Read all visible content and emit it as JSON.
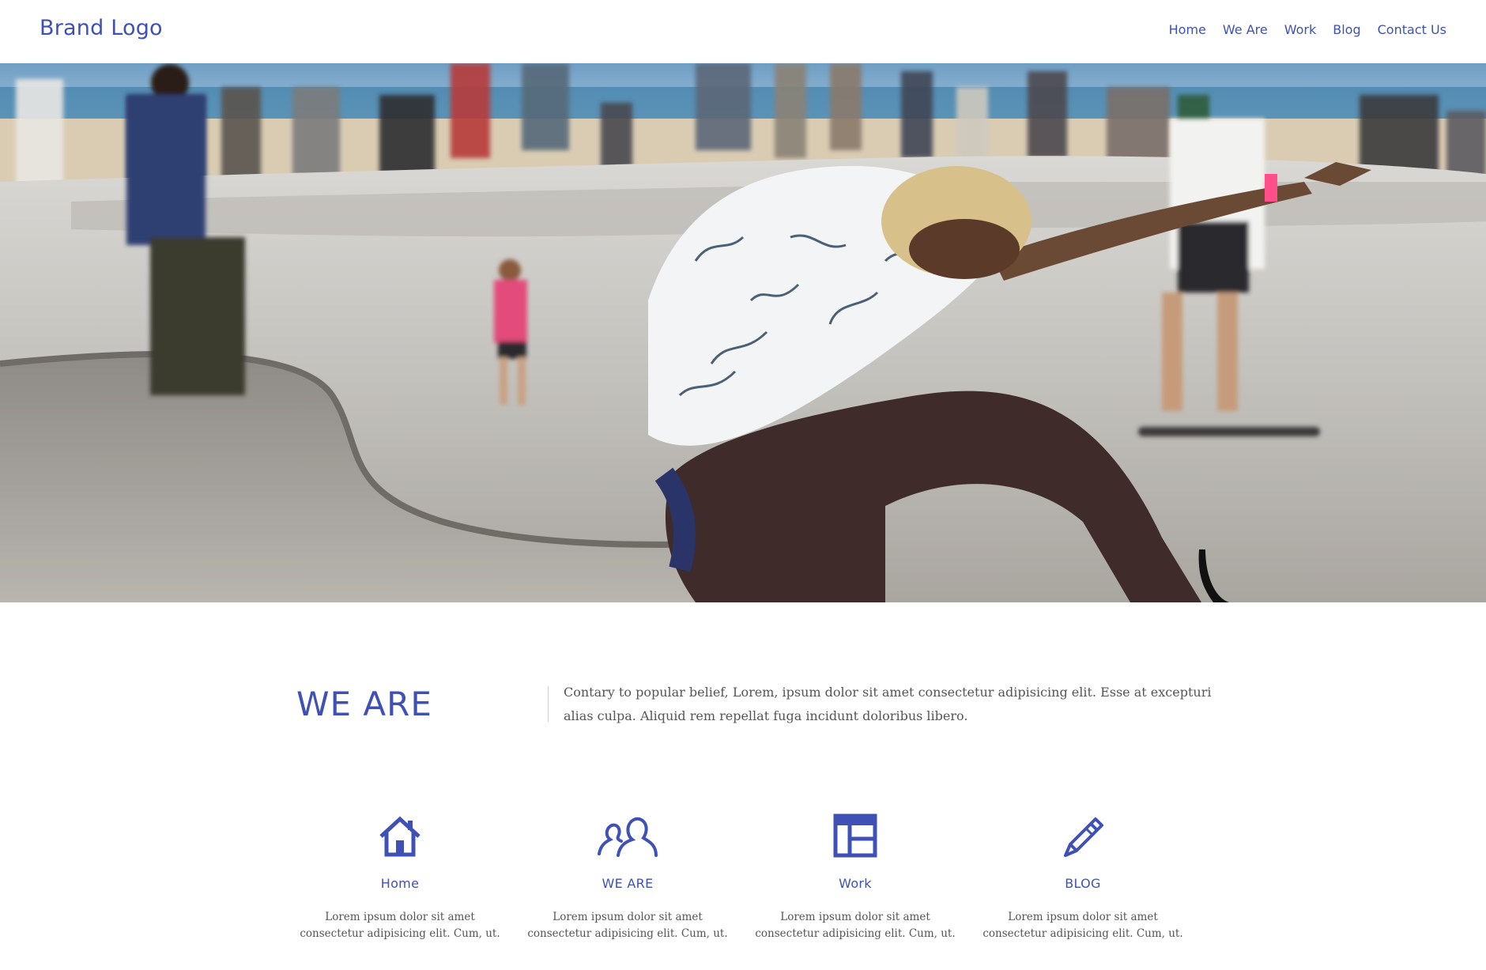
{
  "header": {
    "brand": "Brand Logo",
    "nav": [
      {
        "label": "Home"
      },
      {
        "label": "We Are"
      },
      {
        "label": "Work"
      },
      {
        "label": "Blog"
      },
      {
        "label": "Contact Us"
      }
    ]
  },
  "hero": {
    "image": "skatepark-photo"
  },
  "about": {
    "title": "WE ARE",
    "text": "Contary to popular belief, Lorem, ipsum dolor sit amet consectetur adipisicing elit. Esse at excepturi alias culpa. Aliquid rem repellat fuga incidunt doloribus libero."
  },
  "features": [
    {
      "icon": "home-icon",
      "title": "Home",
      "text": "Lorem ipsum dolor sit amet consectetur adipisicing elit. Cum, ut."
    },
    {
      "icon": "people-icon",
      "title": "WE ARE",
      "text": "Lorem ipsum dolor sit amet consectetur adipisicing elit. Cum, ut."
    },
    {
      "icon": "layout-icon",
      "title": "Work",
      "text": "Lorem ipsum dolor sit amet consectetur adipisicing elit. Cum, ut."
    },
    {
      "icon": "pencil-icon",
      "title": "BLOG",
      "text": "Lorem ipsum dolor sit amet consectetur adipisicing elit. Cum, ut."
    }
  ],
  "colors": {
    "accent": "#3f51b5",
    "body_text": "#555555",
    "background": "#ffffff"
  }
}
